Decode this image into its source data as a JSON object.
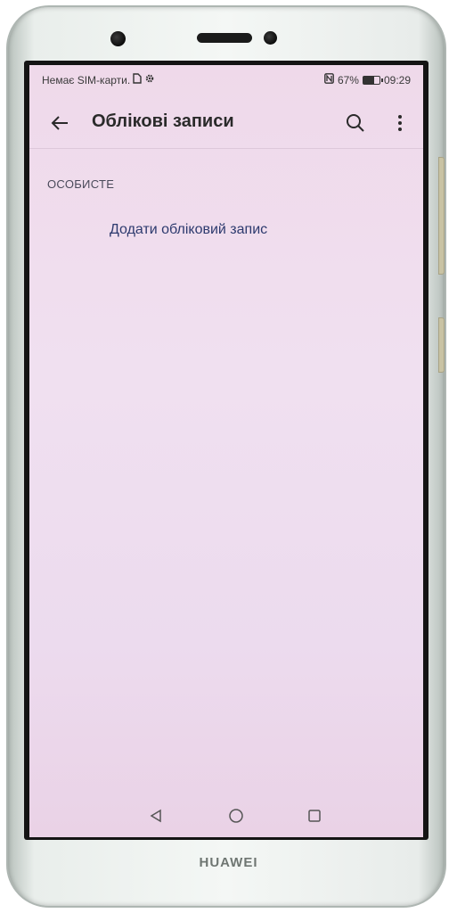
{
  "device": {
    "brand": "HUAWEI"
  },
  "statusbar": {
    "carrier": "Немає SIM-карти.",
    "battery_percent": "67%",
    "time": "09:29",
    "icons": [
      "sim-card-icon",
      "settings-gear-icon",
      "nfc-icon",
      "battery-icon"
    ]
  },
  "toolbar": {
    "title": "Облікові записи",
    "icons": [
      "back-arrow-icon",
      "search-icon",
      "more-options-icon"
    ]
  },
  "content": {
    "section_header": "ОСОБИСТЕ",
    "add_account_label": "Додати обліковий запис"
  },
  "navbar": {
    "icons": [
      "back-triangle-icon",
      "home-circle-icon",
      "recents-square-icon"
    ]
  }
}
